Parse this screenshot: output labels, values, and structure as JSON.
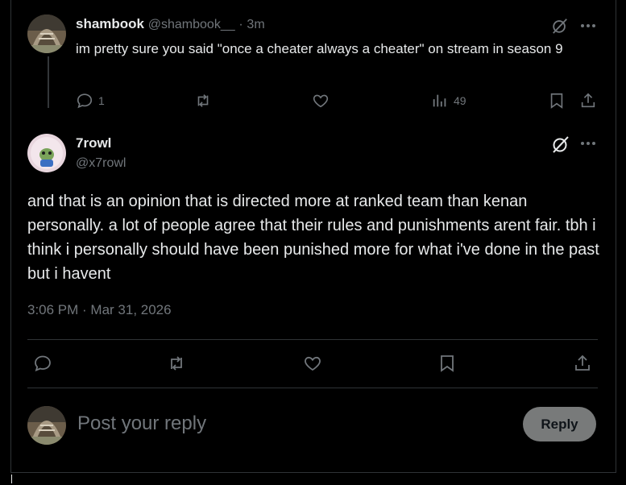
{
  "reply_tweet": {
    "display_name": "shambook",
    "handle": "@shambook__",
    "separator": "·",
    "time_ago": "3m",
    "text": "im pretty sure you said \"once a cheater always a cheater\" on stream in season 9",
    "reply_count": "1",
    "view_count": "49"
  },
  "main_tweet": {
    "display_name": "7rowl",
    "handle": "@x7rowl",
    "text": "and that is an opinion that is directed more at ranked team than kenan personally. a lot of people agree that their rules and punishments arent fair. tbh i think i personally should have been punished more for what i've done in the past but i havent",
    "timestamp": "3:06 PM · Mar 31, 2026"
  },
  "composer": {
    "placeholder": "Post your reply",
    "reply_button": "Reply"
  },
  "icons": {
    "reply": "reply-icon",
    "retweet": "retweet-icon",
    "like": "heart-icon",
    "views": "views-icon",
    "bookmark": "bookmark-icon",
    "share": "share-icon",
    "grok": "grok-icon",
    "more": "more-icon"
  },
  "colors": {
    "background": "#000000",
    "text": "#e7e9ea",
    "muted": "#71767b",
    "border": "#2f3336",
    "reply_button_bg": "#787a7a"
  }
}
